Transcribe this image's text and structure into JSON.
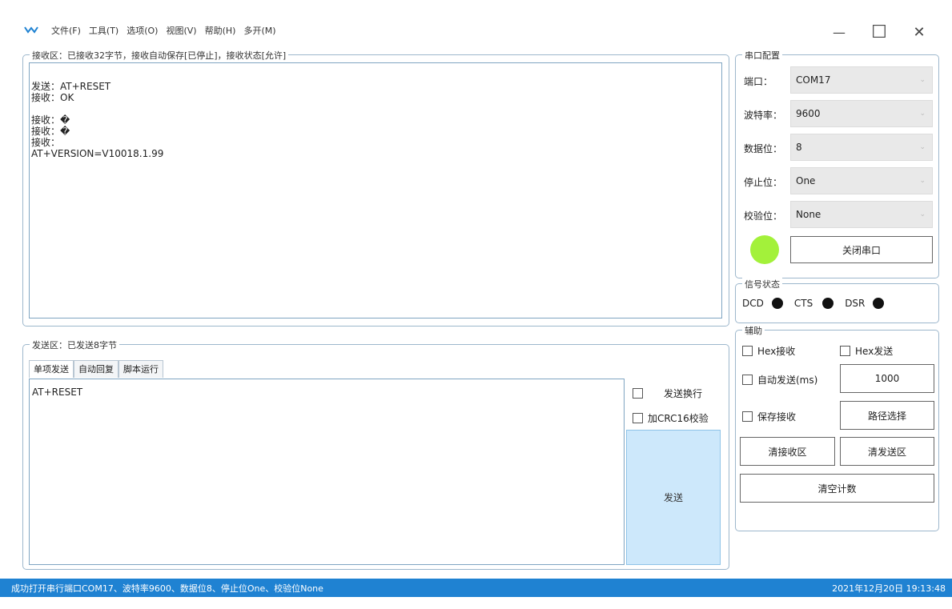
{
  "menu": {
    "items": [
      "文件(F)",
      "工具(T)",
      "选项(O)",
      "视图(V)",
      "帮助(H)",
      "多开(M)"
    ]
  },
  "window": {
    "minimize_glyph": "—",
    "maximize_glyph": "☐",
    "close_glyph": "✕"
  },
  "receive": {
    "title": "接收区：已接收32字节，接收自动保存[已停止]，接收状态[允许]",
    "content": "发送：AT+RESET\n接收：OK\n\n接收：�\n接收：�\n接收：\nAT+VERSION=V10018.1.99"
  },
  "send": {
    "title": "发送区：已发送8字节",
    "tabs": [
      "单项发送",
      "自动回复",
      "脚本运行"
    ],
    "input_value": "AT+RESET",
    "newline_label": "发送换行",
    "crc_label": "加CRC16校验",
    "send_button": "发送"
  },
  "port_config": {
    "title": "串口配置",
    "fields": [
      {
        "label": "端口：",
        "value": "COM17"
      },
      {
        "label": "波特率：",
        "value": "9600"
      },
      {
        "label": "数据位：",
        "value": "8"
      },
      {
        "label": "停止位：",
        "value": "One"
      },
      {
        "label": "校验位：",
        "value": "None"
      }
    ],
    "close_button": "关闭串口",
    "led_color": "#a3f13a"
  },
  "signal": {
    "title": "信号状态",
    "items": [
      "DCD",
      "CTS",
      "DSR"
    ]
  },
  "aux": {
    "title": "辅助",
    "hex_recv": "Hex接收",
    "hex_send": "Hex发送",
    "auto_send": "自动发送(ms)",
    "interval": "1000",
    "save_recv": "保存接收",
    "path_button": "路径选择",
    "clear_recv": "清接收区",
    "clear_send": "清发送区",
    "clear_count": "清空计数"
  },
  "status": {
    "message": "成功打开串行端口COM17、波特率9600、数据位8、停止位One、校验位None",
    "datetime": "2021年12月20日 19:13:48"
  },
  "colors": {
    "status_bg": "#1f82d2",
    "send_button_bg": "#cde8fb",
    "group_border": "#9db7cc"
  }
}
